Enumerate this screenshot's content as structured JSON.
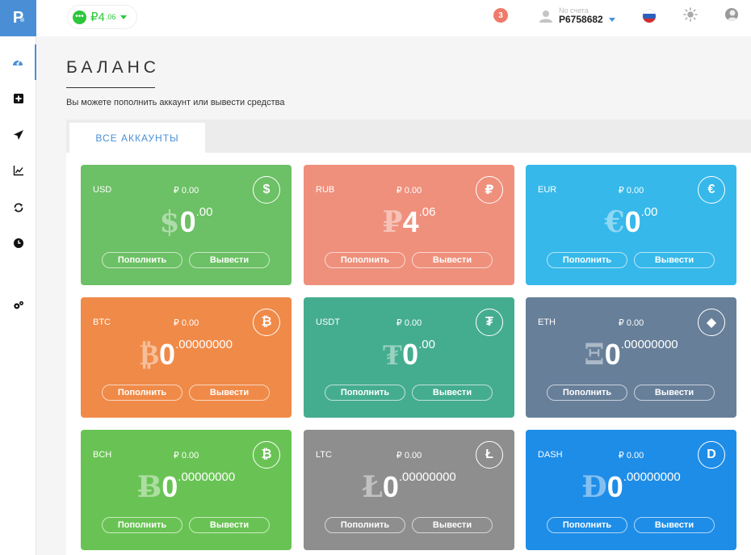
{
  "logo": {
    "letter": "P",
    "mark": "®"
  },
  "sidebar": {
    "items": [
      {
        "name": "dashboard-icon",
        "active": true
      },
      {
        "name": "add-icon",
        "active": false
      },
      {
        "name": "send-icon",
        "active": false
      },
      {
        "name": "chart-icon",
        "active": false
      },
      {
        "name": "exchange-icon",
        "active": false
      },
      {
        "name": "clock-icon",
        "active": false
      },
      {
        "name": "settings-icon",
        "active": false
      }
    ]
  },
  "topbar": {
    "balance_symbol": "₽",
    "balance_int": "4",
    "balance_frac": ".06",
    "notifications": "3",
    "account_label": "No счета",
    "account_number": "P6758682",
    "language_flag": "ru-flag-icon",
    "theme_icon": "sun-icon",
    "user_icon": "avatar-icon"
  },
  "page": {
    "title": "БАЛАНС",
    "subtitle": "Вы можете пополнить аккаунт или вывести средства",
    "tab": "ВСЕ АККАУНТЫ"
  },
  "labels": {
    "deposit": "Пополнить",
    "withdraw": "Вывести"
  },
  "cards": [
    {
      "code": "USD",
      "small": "₽ 0.00",
      "icon": "$",
      "sym": "$",
      "int": "0",
      "frac": ".00",
      "color": "#6cc065"
    },
    {
      "code": "RUB",
      "small": "₽ 0.00",
      "icon": "₽",
      "sym": "₽",
      "int": "4",
      "frac": ".06",
      "color": "#ef907c"
    },
    {
      "code": "EUR",
      "small": "₽ 0.00",
      "icon": "€",
      "sym": "€",
      "int": "0",
      "frac": ".00",
      "color": "#36b8ea"
    },
    {
      "code": "BTC",
      "small": "₽ 0.00",
      "icon": "₿",
      "sym": "₿",
      "int": "0",
      "frac": ".00000000",
      "color": "#f08a48"
    },
    {
      "code": "USDT",
      "small": "₽ 0.00",
      "icon": "₮",
      "sym": "₮",
      "int": "0",
      "frac": ".00",
      "color": "#45ad8f"
    },
    {
      "code": "ETH",
      "small": "₽ 0.00",
      "icon": "◆",
      "sym": "Ξ",
      "int": "0",
      "frac": ".00000000",
      "color": "#677f99"
    },
    {
      "code": "BCH",
      "small": "₽ 0.00",
      "icon": "₿",
      "sym": "Ƀ",
      "int": "0",
      "frac": ".00000000",
      "color": "#69c354"
    },
    {
      "code": "LTC",
      "small": "₽ 0.00",
      "icon": "Ł",
      "sym": "Ł",
      "int": "0",
      "frac": ".00000000",
      "color": "#8e8e8e"
    },
    {
      "code": "DASH",
      "small": "₽ 0.00",
      "icon": "D",
      "sym": "Đ",
      "int": "0",
      "frac": ".00000000",
      "color": "#1e8de8"
    }
  ]
}
